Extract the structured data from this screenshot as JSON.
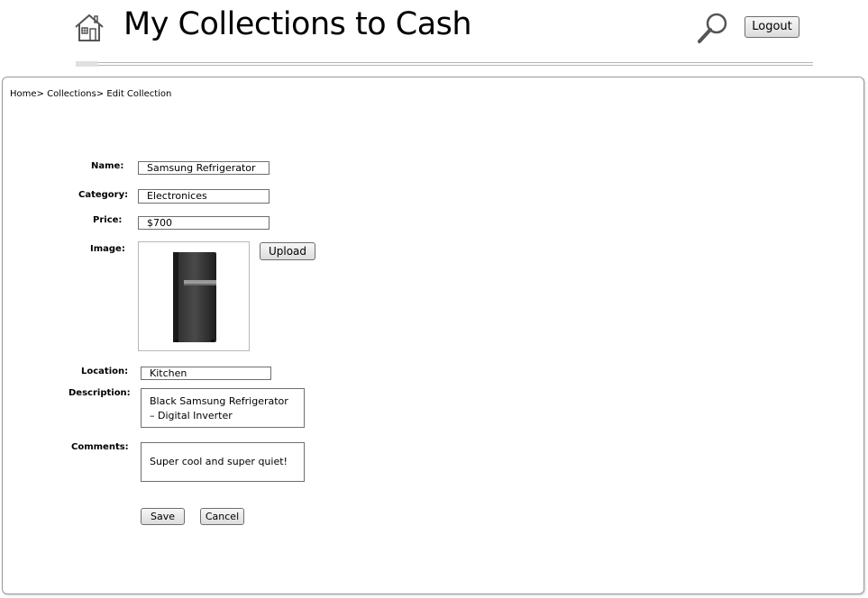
{
  "header": {
    "title": "My Collections to Cash",
    "logout_label": "Logout"
  },
  "breadcrumb": {
    "home": "Home",
    "collections": "Collections",
    "current": "Edit Collection",
    "separator": ">"
  },
  "form": {
    "name_label": "Name:",
    "name_value": "Samsung Refrigerator",
    "category_label": "Category:",
    "category_value": "Electronices",
    "price_label": "Price:",
    "price_value": "$700",
    "image_label": "Image:",
    "upload_label": "Upload",
    "location_label": "Location:",
    "location_value": "Kitchen",
    "description_label": "Description:",
    "description_value": "Black Samsung Refrigerator – Digital Inverter",
    "comments_label": "Comments:",
    "comments_value": "Super cool and super quiet!",
    "save_label": "Save",
    "cancel_label": "Cancel"
  },
  "icons": {
    "home": "home-icon",
    "search": "search-icon",
    "product_image": "refrigerator-image"
  }
}
